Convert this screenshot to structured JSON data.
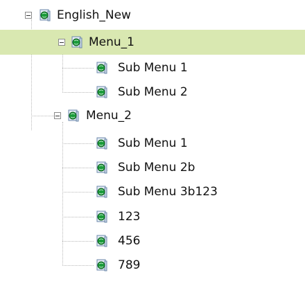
{
  "tree": {
    "root": {
      "label": "English_New"
    },
    "menu1": {
      "label": "Menu_1",
      "children": [
        "Sub Menu 1",
        "Sub Menu 2"
      ]
    },
    "menu2": {
      "label": "Menu_2",
      "children": [
        "Sub Menu 1",
        "Sub Menu 2b",
        "Sub Menu 3b123",
        "123",
        "456",
        "789"
      ]
    }
  },
  "colors": {
    "selection_bg": "#d9e8b1",
    "connector": "#b8b8b8"
  },
  "icons": {
    "node_icon": "page-globe-icon",
    "collapse_toggle": "minus-box-icon"
  }
}
